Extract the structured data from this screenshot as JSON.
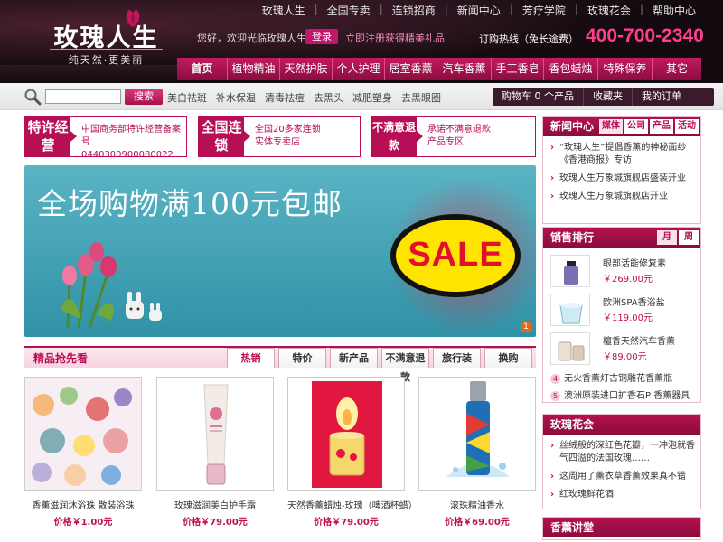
{
  "header": {
    "logo_text": "玫瑰人生",
    "slogan": "纯天然·更美丽",
    "top_links": [
      "玫瑰人生",
      "全国专卖",
      "连锁招商",
      "新闻中心",
      "芳疗学院",
      "玫瑰花会",
      "帮助中心"
    ],
    "welcome": "您好，欢迎光临玫瑰人生。",
    "login_label": "登录",
    "register_text": "立即注册获得精美礼品",
    "hotline_label": "订购热线（免长途费）",
    "hotline": "400-700-2340",
    "nav": [
      "首页",
      "植物精油",
      "天然护肤",
      "个人护理",
      "居室香薰",
      "汽车香薰",
      "手工香皂",
      "香包蜡烛",
      "特殊保养",
      "其它"
    ]
  },
  "search": {
    "button_label": "搜索",
    "quick_links": [
      "美白祛斑",
      "补水保湿",
      "清毒祛痘",
      "去黑头",
      "减肥塑身",
      "去黑眼圈"
    ],
    "cart_label": "购物车 0 个产品",
    "favorites_label": "收藏夹",
    "orders_label": "我的订单"
  },
  "features": [
    {
      "badge": "特许经营",
      "text_lines": [
        "中国商务部特许经营备案号",
        "0440300900080022"
      ]
    },
    {
      "badge": "全国连锁",
      "text_lines": [
        "全国20多家连锁",
        "实体专卖店"
      ]
    },
    {
      "badge": "不满意退款",
      "text_lines": [
        "承诺不满意退款",
        "产品专区"
      ]
    }
  ],
  "banner": {
    "title": "全场购物满100元包邮",
    "sale_text": "SALE",
    "page_button": "1"
  },
  "products_section": {
    "title": "精品抢先看",
    "tabs": [
      "热销",
      "特价",
      "新产品",
      "不满意退款",
      "旅行装",
      "换购"
    ],
    "items": [
      {
        "name": "香薰滋润沐浴珠 散装浴珠",
        "price": "价格￥1.00元"
      },
      {
        "name": "玫瑰滋润美白护手霜",
        "price": "价格￥79.00元"
      },
      {
        "name": "天然香薰蜡烛-玫瑰（啤酒杯蜡）",
        "price": "价格￥79.00元"
      },
      {
        "name": "滚珠精油香水",
        "price": "价格￥69.00元"
      }
    ]
  },
  "news": {
    "title": "新闻中心",
    "tabs": [
      "媒体",
      "公司",
      "产品",
      "活动"
    ],
    "items": [
      "“玫瑰人生”提倡香薰的神秘面纱《香港商报》专访",
      "玫瑰人生万象城旗舰店盛装开业",
      "玫瑰人生万象城旗舰店开业"
    ]
  },
  "ranking": {
    "title": "销售排行",
    "tabs": [
      "月",
      "周"
    ],
    "items": [
      {
        "name": "眼部活能修复素",
        "price": "￥269.00元"
      },
      {
        "name": "欧洲SPA香浴盐",
        "price": "￥119.00元"
      },
      {
        "name": "檀香天然汽车香薰",
        "price": "￥89.00元"
      }
    ],
    "text_items": [
      {
        "num": "4",
        "name": "无火香薰灯古铜雕花香薰瓶"
      },
      {
        "num": "5",
        "name": "澳洲原装进口扩香石P 香薰器具"
      }
    ]
  },
  "club": {
    "title": "玫瑰花会",
    "items": [
      "丝绒般的深红色花瓣，一冲泡就香气四溢的法国玫瑰……",
      "这周用了薰衣草香薰效果真不错",
      "红玫瑰鲜花酒"
    ]
  },
  "classroom": {
    "title": "香薰讲堂"
  },
  "colors": {
    "brand": "#b70f55",
    "hotline": "#ff3d8f",
    "header_bg": "#120a0e",
    "banner_bg": "#3d9fb3"
  }
}
